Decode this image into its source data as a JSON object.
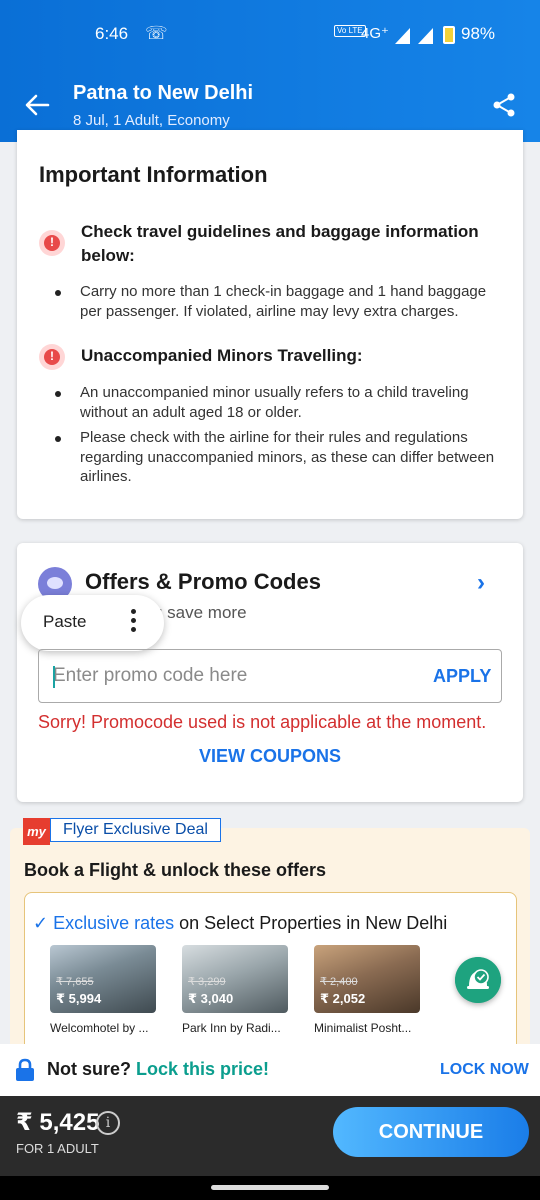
{
  "status_bar": {
    "time": "6:46",
    "volte": "Vo LTE",
    "network": "4G⁺",
    "battery": "98%"
  },
  "header": {
    "title": "Patna to New Delhi",
    "subtitle": "8 Jul, 1 Adult, Economy"
  },
  "important_info": {
    "heading": "Important Information",
    "sections": [
      {
        "title": "Check travel guidelines and baggage information below:",
        "bullets": [
          "Carry no more than 1 check-in baggage and 1 hand baggage per passenger. If violated, airline may levy extra charges."
        ]
      },
      {
        "title": "Unaccompanied Minors Travelling:",
        "bullets": [
          "An unaccompanied minor usually refers to a child traveling without an adult aged 18 or older.",
          "Please check with the airline for their rules and regulations regarding unaccompanied minors, as these can differ between airlines."
        ]
      }
    ]
  },
  "offers": {
    "title": "Offers & Promo Codes",
    "subtitle_visible": "u save more",
    "paste_label": "Paste",
    "input_placeholder": "Enter promo code here",
    "apply_label": "APPLY",
    "error": "Sorry! Promocode used is not applicable at the moment.",
    "view_coupons": "VIEW COUPONS"
  },
  "flyer": {
    "logo_text": "my",
    "badge": "Flyer Exclusive Deal",
    "heading": "Book a Flight & unlock these offers",
    "rates_highlight": "Exclusive rates",
    "rates_rest": " on Select Properties in New Delhi",
    "hotels": [
      {
        "old_price": "₹ 7,655",
        "price": "₹ 5,994",
        "name": "Welcomhotel by ..."
      },
      {
        "old_price": "₹ 3,299",
        "price": "₹ 3,040",
        "name": "Park Inn by Radi..."
      },
      {
        "old_price": "₹ 2,400",
        "price": "₹ 2,052",
        "name": "Minimalist Posht..."
      }
    ]
  },
  "lock": {
    "text": "Not sure? ",
    "highlight": "Lock this price!",
    "action": "LOCK NOW"
  },
  "footer": {
    "price": "₹ 5,425",
    "info_glyph": "i",
    "sub": "FOR 1 ADULT",
    "cta": "CONTINUE"
  },
  "colors": {
    "header_blue": "#0a6fd6",
    "link_blue": "#1a73e8",
    "error_red": "#d32f2f",
    "teal": "#0b9e8e"
  }
}
